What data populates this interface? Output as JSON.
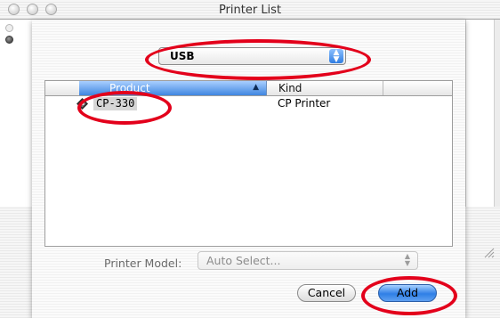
{
  "window": {
    "title": "Printer List"
  },
  "connection": {
    "selected": "USB"
  },
  "table": {
    "columns": {
      "product": "Product",
      "kind": "Kind"
    },
    "rows": [
      {
        "product": "CP-330",
        "kind": "CP Printer",
        "icon": "printer-icon"
      }
    ]
  },
  "printer_model": {
    "label": "Printer Model:",
    "value": "Auto Select..."
  },
  "buttons": {
    "cancel": "Cancel",
    "add": "Add"
  },
  "colors": {
    "annotation": "#e3001b",
    "selection_blue": "#3f86e0"
  }
}
